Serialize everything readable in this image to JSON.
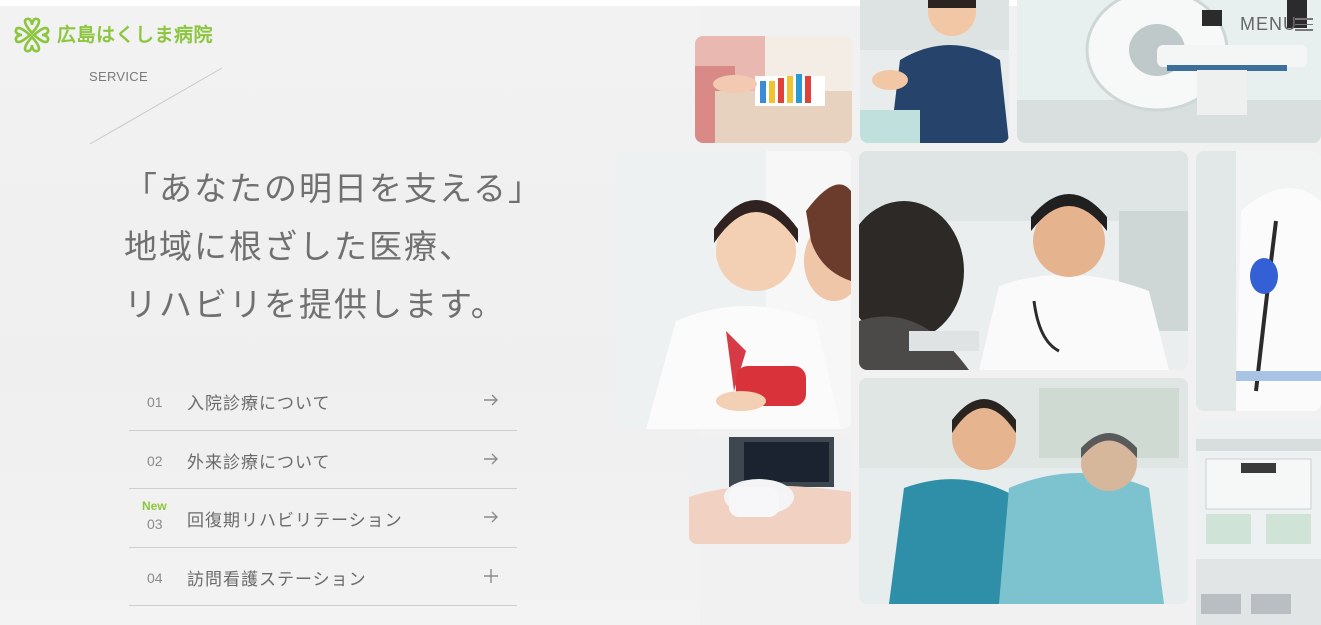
{
  "header": {
    "logo_text": "広島はくしま病院",
    "menu_label": "MENU"
  },
  "section": {
    "label": "SERVICE"
  },
  "heading": {
    "line1": "「あなたの明日を支える」",
    "line2": "地域に根ざした医療、",
    "line3": "リハビリを提供します。"
  },
  "services": [
    {
      "num": "01",
      "label": "入院診療について",
      "badge": "",
      "icon": "arrow-right-icon"
    },
    {
      "num": "02",
      "label": "外来診療について",
      "badge": "",
      "icon": "arrow-right-icon"
    },
    {
      "num": "03",
      "label": "回復期リハビリテーション",
      "badge": "New",
      "icon": "arrow-right-icon"
    },
    {
      "num": "04",
      "label": "訪問看護ステーション",
      "badge": "",
      "icon": "plus-icon"
    }
  ],
  "colors": {
    "accent_green": "#8cc63f",
    "background": "#f1f1f1",
    "text": "#6a6a6a",
    "divider": "#cfcfcf"
  }
}
